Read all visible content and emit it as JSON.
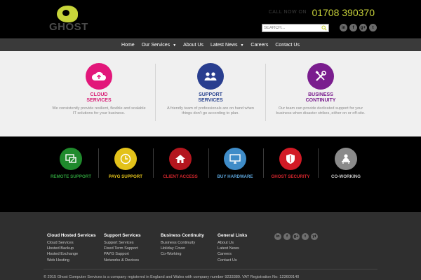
{
  "header": {
    "logo_text": "GHOST",
    "call_label": "CALL NOW ON",
    "phone": "01708 390370",
    "search_placeholder": "SEARCH...",
    "social": [
      "in",
      "f",
      "g+",
      "t"
    ]
  },
  "nav": {
    "items": [
      {
        "label": "Home",
        "dropdown": false
      },
      {
        "label": "Our Services",
        "dropdown": true
      },
      {
        "label": "About Us",
        "dropdown": false
      },
      {
        "label": "Latest News",
        "dropdown": true
      },
      {
        "label": "Careers",
        "dropdown": false
      },
      {
        "label": "Contact Us",
        "dropdown": false
      }
    ]
  },
  "services": [
    {
      "title_line1": "CLOUD",
      "title_line2": "SERVICES",
      "description": "We consistently provide resilient, flexible and scalable IT solutions for your business.",
      "icon": "cloud-upload-icon",
      "color": "#e2177a",
      "title_color": "#d81b74"
    },
    {
      "title_line1": "SUPPORT",
      "title_line2": "SERVICES",
      "description": "A friendly team of professionals are on hand when things don't go according to plan.",
      "icon": "people-icon",
      "color": "#293e8f",
      "title_color": "#2b4590"
    },
    {
      "title_line1": "BUSINESS",
      "title_line2": "CONTINUITY",
      "description": "Our team can provide dedicated support for your business when disaster strikes, either on or off-site.",
      "icon": "tools-icon",
      "color": "#7a1d8e",
      "title_color": "#7a1d8e"
    }
  ],
  "features": [
    {
      "label": "REMOTE SUPPORT",
      "color": "#1f8a2c",
      "label_color": "#2d9b3a",
      "icon": "remote-support-icon"
    },
    {
      "label": "PAYG SUPPORT",
      "color": "#e3c21a",
      "label_color": "#e3c21a",
      "icon": "clock-icon"
    },
    {
      "label": "CLIENT ACCESS",
      "color": "#b3161e",
      "label_color": "#d1262c",
      "icon": "house-icon"
    },
    {
      "label": "BUY HARDWARE",
      "color": "#3f8cc8",
      "label_color": "#5aa1d6",
      "icon": "monitor-icon"
    },
    {
      "label": "GHOST SECURITY",
      "color": "#d21a25",
      "label_color": "#d8262e",
      "icon": "shield-icon"
    },
    {
      "label": "CO-WORKING",
      "color": "#8a8a8a",
      "label_color": "#c9c9c9",
      "icon": "person-desk-icon"
    }
  ],
  "footer": {
    "columns": [
      {
        "heading": "Cloud Hosted Services",
        "links": [
          "Cloud Services",
          "Hosted Backup",
          "Hosted Exchange",
          "Web Hosting"
        ]
      },
      {
        "heading": "Support Services",
        "links": [
          "Support Services",
          "Fixed Term Support",
          "PAYG Support",
          "Networks & Devices"
        ]
      },
      {
        "heading": "Business Continuity",
        "links": [
          "Business Continuity",
          "Holiday Cover",
          "Co-Working"
        ]
      },
      {
        "heading": "General Links",
        "links": [
          "About Us",
          "Latest News",
          "Careers",
          "Contact Us"
        ]
      }
    ],
    "social": [
      "in",
      "f",
      "g+",
      "t",
      "yt"
    ],
    "copyright": "© 2015 Ghost Computer Services is a company registered in England and Wales with company number 9233389. VAT Registration No: 123609140"
  }
}
